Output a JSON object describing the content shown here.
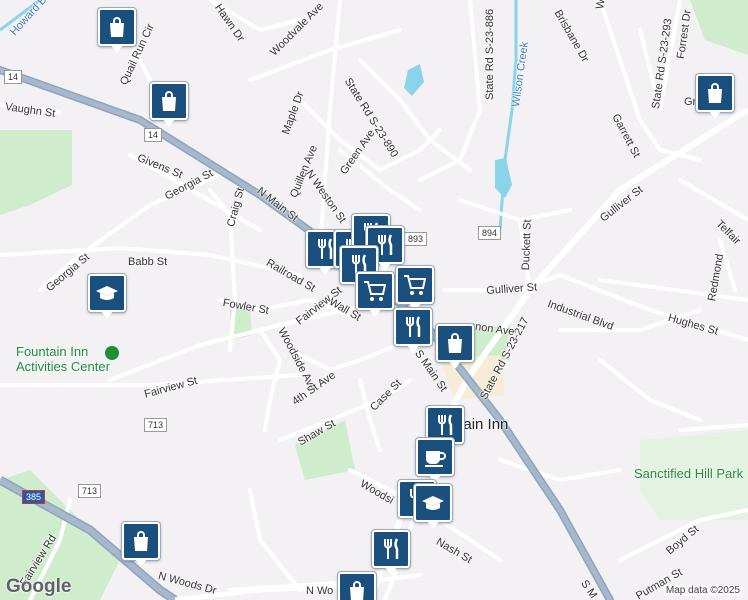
{
  "map": {
    "attribution": "Map data ©2025",
    "logo": "Google",
    "colors": {
      "background": "#f3f1f3",
      "road": "#ffffff",
      "highway": "#8fa4bc",
      "park": "#cfeccd",
      "water": "#8ad4ea",
      "marker": "#1a4f7e",
      "poi_green": "#1e8e3e",
      "poi_purple": "#7b6aa8"
    }
  },
  "roads": {
    "howard_br": "Howard Br",
    "hawn_dr": "Hawn Dr",
    "woodvale_ave": "Woodvale Ave",
    "quail_run_cir": "Quail Run Cir",
    "vaughn_st": "Vaughn St",
    "maple_dr": "Maple Dr",
    "state_rd_890": "State Rd S-23-890",
    "givens_st": "Givens St",
    "georgia_st_north": "Georgia St",
    "quillen_ave": "Quillen Ave",
    "green_ave": "Green Ave",
    "n_weston_st": "N Weston St",
    "n_main_st": "N Main St",
    "craig_st": "Craig St",
    "babb_st": "Babb St",
    "georgia_st_south": "Georgia St",
    "railroad_st": "Railroad St",
    "fowler_st": "Fowler St",
    "fairview_st_upper": "Fairview St",
    "wall_st": "Wall St",
    "woodside_ave": "Woodside Ave",
    "fourth_st_ave": "4th St Ave",
    "fairview_st_lower": "Fairview St",
    "shaw_st": "Shaw St",
    "case_st": "Case St",
    "s_main_st": "S Main St",
    "s_main_st_bottom": "S M",
    "woodside_lower": "Woodsi",
    "nash_st": "Nash St",
    "fairview_rd": "Fairview Rd",
    "n_woods_dr": "N Woods Dr",
    "n_wo": "N Wo",
    "state_rd_886": "State Rd S-23-886",
    "wilson_creek": "Wilson Creek",
    "brisbane_dr": "Brisbane Dr",
    "state_rd_293": "State Rd S-23-293",
    "forrest_dr": "Forrest Dr",
    "way": "Way",
    "garrett_st": "Garrett St",
    "gri": "Gri",
    "gulliver_st": "Gulliver St",
    "gulliver_st_lower": "Gulliver St",
    "duckett_st": "Duckett St",
    "industrial_blvd": "Industrial Blvd",
    "hughes_st": "Hughes St",
    "telfair": "Telfair",
    "redmond": "Redmond",
    "state_rd_217": "State Rd S-23-217",
    "cannon_ave": "nnon Ave",
    "boyd_st": "Boyd St",
    "putman_st": "Putman St"
  },
  "shields": {
    "r14_top": "14",
    "r14_mid": "14",
    "r893": "893",
    "r894": "894",
    "r713_a": "713",
    "r713_b": "713",
    "i385": "385"
  },
  "places": {
    "activities_center": "Fountain Inn\nActivities Center",
    "town": "Fountain Inn",
    "sanctified_hill": "Sanctified Hill Park"
  },
  "markers": [
    {
      "type": "shopping",
      "icon": "shopping-bag-icon"
    },
    {
      "type": "shopping",
      "icon": "shopping-bag-icon"
    },
    {
      "type": "shopping",
      "icon": "shopping-bag-icon"
    },
    {
      "type": "education",
      "icon": "graduation-cap-icon"
    },
    {
      "type": "restaurant",
      "icon": "fork-knife-icon"
    },
    {
      "type": "restaurant",
      "icon": "fork-knife-icon"
    },
    {
      "type": "restaurant",
      "icon": "fork-knife-icon"
    },
    {
      "type": "restaurant",
      "icon": "fork-knife-icon"
    },
    {
      "type": "restaurant",
      "icon": "fork-knife-icon"
    },
    {
      "type": "grocery",
      "icon": "shopping-cart-icon"
    },
    {
      "type": "grocery",
      "icon": "shopping-cart-icon"
    },
    {
      "type": "restaurant",
      "icon": "fork-knife-icon"
    },
    {
      "type": "shopping",
      "icon": "shopping-bag-icon"
    },
    {
      "type": "restaurant",
      "icon": "fork-knife-icon"
    },
    {
      "type": "cafe",
      "icon": "coffee-cup-icon"
    },
    {
      "type": "restaurant",
      "icon": "fork-knife-icon"
    },
    {
      "type": "education",
      "icon": "graduation-cap-icon"
    },
    {
      "type": "restaurant",
      "icon": "fork-knife-icon"
    },
    {
      "type": "shopping",
      "icon": "shopping-bag-icon"
    },
    {
      "type": "shopping",
      "icon": "shopping-bag-icon"
    }
  ]
}
